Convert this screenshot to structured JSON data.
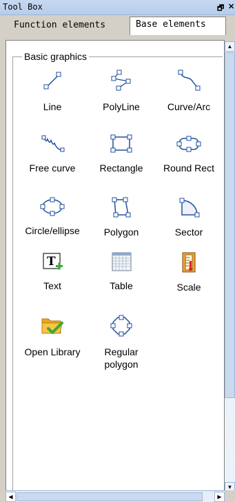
{
  "window": {
    "title": "Tool Box",
    "pin_icon": "pin-icon",
    "close_icon": "close-icon"
  },
  "tabs": [
    {
      "label": "Function elements",
      "active": false
    },
    {
      "label": "Base elements",
      "active": true
    }
  ],
  "group": {
    "label": "Basic graphics"
  },
  "tools": [
    {
      "label": "Line",
      "icon": "line-icon"
    },
    {
      "label": "PolyLine",
      "icon": "polyline-icon"
    },
    {
      "label": "Curve/Arc",
      "icon": "curve-arc-icon"
    },
    {
      "label": "Free curve",
      "icon": "free-curve-icon"
    },
    {
      "label": "Rectangle",
      "icon": "rectangle-icon"
    },
    {
      "label": "Round Rect",
      "icon": "round-rect-icon"
    },
    {
      "label": "Circle/ellipse",
      "icon": "circle-ellipse-icon"
    },
    {
      "label": "Polygon",
      "icon": "polygon-icon"
    },
    {
      "label": "Sector",
      "icon": "sector-icon"
    },
    {
      "label": "Text",
      "icon": "text-icon"
    },
    {
      "label": "Table",
      "icon": "table-icon"
    },
    {
      "label": "Scale",
      "icon": "scale-icon"
    },
    {
      "label": "Open Library",
      "icon": "open-library-icon"
    },
    {
      "label": "Regular\npolygon",
      "icon": "regular-polygon-icon"
    }
  ],
  "colors": {
    "window_bg": "#d4d0c8",
    "titlebar": "#c7d8f0",
    "panel_bg": "#ffffff",
    "handle": "#1e4f9c",
    "folder": "#f0b428",
    "check": "#3aa83a"
  }
}
